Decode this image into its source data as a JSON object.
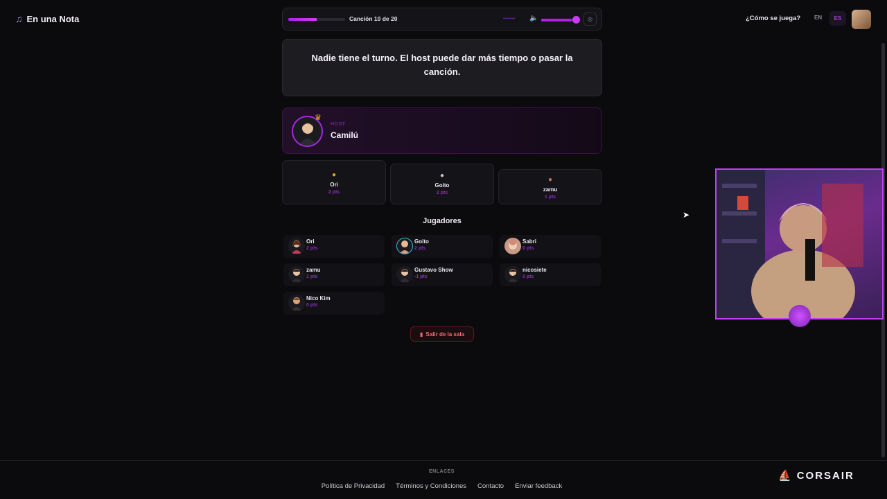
{
  "brand": {
    "icon": "music-note-icon",
    "name": "En una Nota"
  },
  "player": {
    "song_label": "Canción 10 de 20",
    "progress": 0.5,
    "volume": 0.85,
    "timer_dots": "••••••"
  },
  "header": {
    "how_to_play": "¿Cómo se juega?",
    "lang_en": "EN",
    "lang_es": "ES"
  },
  "message": "Nadie tiene el turno. El host puede dar más tiempo o pasar la canción.",
  "host": {
    "tag": "HOST",
    "name": "Camilú"
  },
  "podium": [
    {
      "place": "gold-medal-icon",
      "name": "Ori",
      "points": "2 pts"
    },
    {
      "place": "silver-medal-icon",
      "name": "Goito",
      "points": "2 pts"
    },
    {
      "place": "bronze-medal-icon",
      "name": "zamu",
      "points": "1 pts"
    }
  ],
  "players_title": "Jugadores",
  "players": [
    {
      "name": "Ori",
      "points": "2 pts"
    },
    {
      "name": "Goito",
      "points": "2 pts"
    },
    {
      "name": "Sabri",
      "points": "0 pts"
    },
    {
      "name": "zamu",
      "points": "1 pts"
    },
    {
      "name": "Gustavo Show",
      "points": "-1 pts"
    },
    {
      "name": "nicosiete",
      "points": "0 pts"
    },
    {
      "name": "Nico Kim",
      "points": "0 pts"
    }
  ],
  "leave_button": "Salir de la sala",
  "footer": {
    "title": "ENLACES",
    "links": [
      "Política de Privacidad",
      "Términos y Condiciones",
      "Contacto",
      "Enviar feedback"
    ]
  },
  "overlay": {
    "sponsor": "CORSAIR"
  },
  "colors": {
    "accent": "#b21ff0",
    "background": "#0b0a0d",
    "danger": "#ef6f73"
  }
}
